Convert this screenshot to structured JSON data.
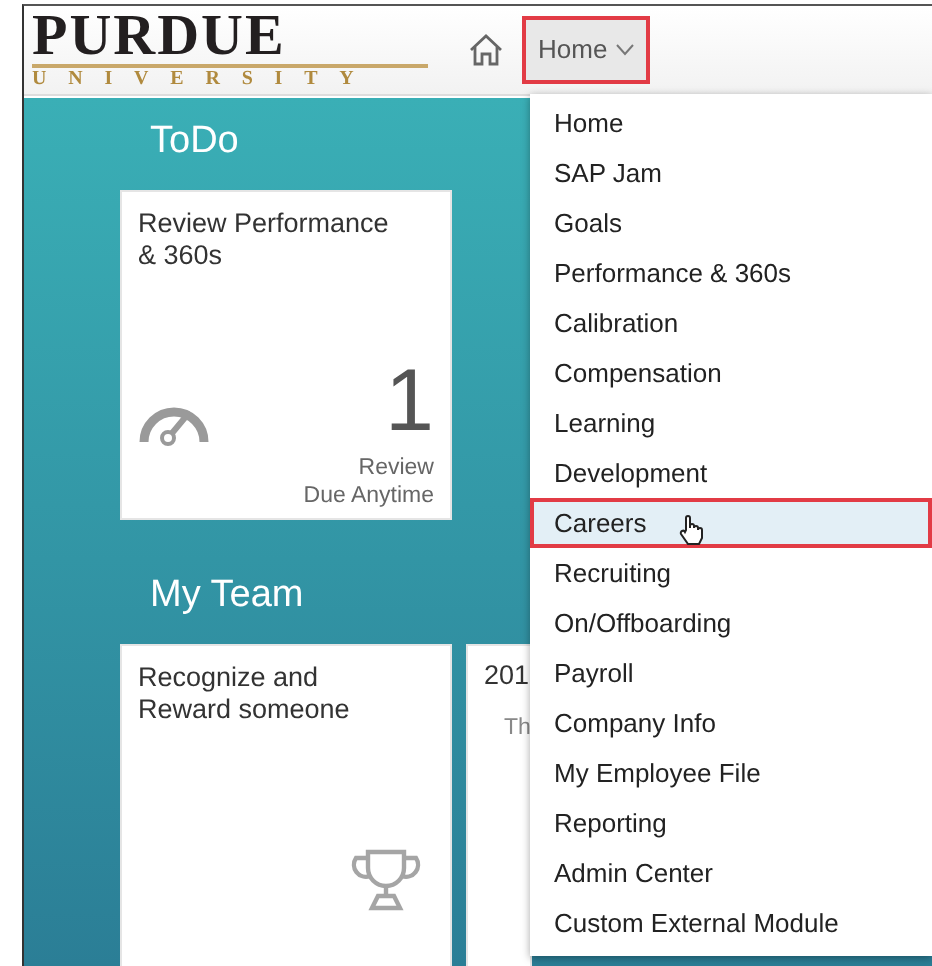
{
  "header": {
    "logo": {
      "name": "PURDUE",
      "subtitle": "UNIVERSITY"
    },
    "nav_button": {
      "label": "Home",
      "expanded": true
    }
  },
  "sections": [
    {
      "title": "ToDo",
      "tiles": [
        {
          "kind": "count",
          "title": "Review Performance & 360s",
          "count": "1",
          "caption": [
            "Review",
            "Due Anytime"
          ]
        }
      ]
    },
    {
      "title": "My Team",
      "tiles": [
        {
          "kind": "award",
          "title": "Recognize and Reward someone"
        },
        {
          "kind": "partial",
          "title": "201",
          "subtitle": "Th"
        }
      ]
    }
  ],
  "menu": [
    {
      "label": "Home",
      "selected": false
    },
    {
      "label": "SAP Jam",
      "selected": false
    },
    {
      "label": "Goals",
      "selected": false
    },
    {
      "label": "Performance & 360s",
      "selected": false
    },
    {
      "label": "Calibration",
      "selected": false
    },
    {
      "label": "Compensation",
      "selected": false
    },
    {
      "label": "Learning",
      "selected": false
    },
    {
      "label": "Development",
      "selected": false
    },
    {
      "label": "Careers",
      "selected": true
    },
    {
      "label": "Recruiting",
      "selected": false
    },
    {
      "label": "On/Offboarding",
      "selected": false
    },
    {
      "label": "Payroll",
      "selected": false
    },
    {
      "label": "Company Info",
      "selected": false
    },
    {
      "label": "My Employee File",
      "selected": false
    },
    {
      "label": "Reporting",
      "selected": false
    },
    {
      "label": "Admin Center",
      "selected": false
    },
    {
      "label": "Custom External Module",
      "selected": false
    }
  ]
}
